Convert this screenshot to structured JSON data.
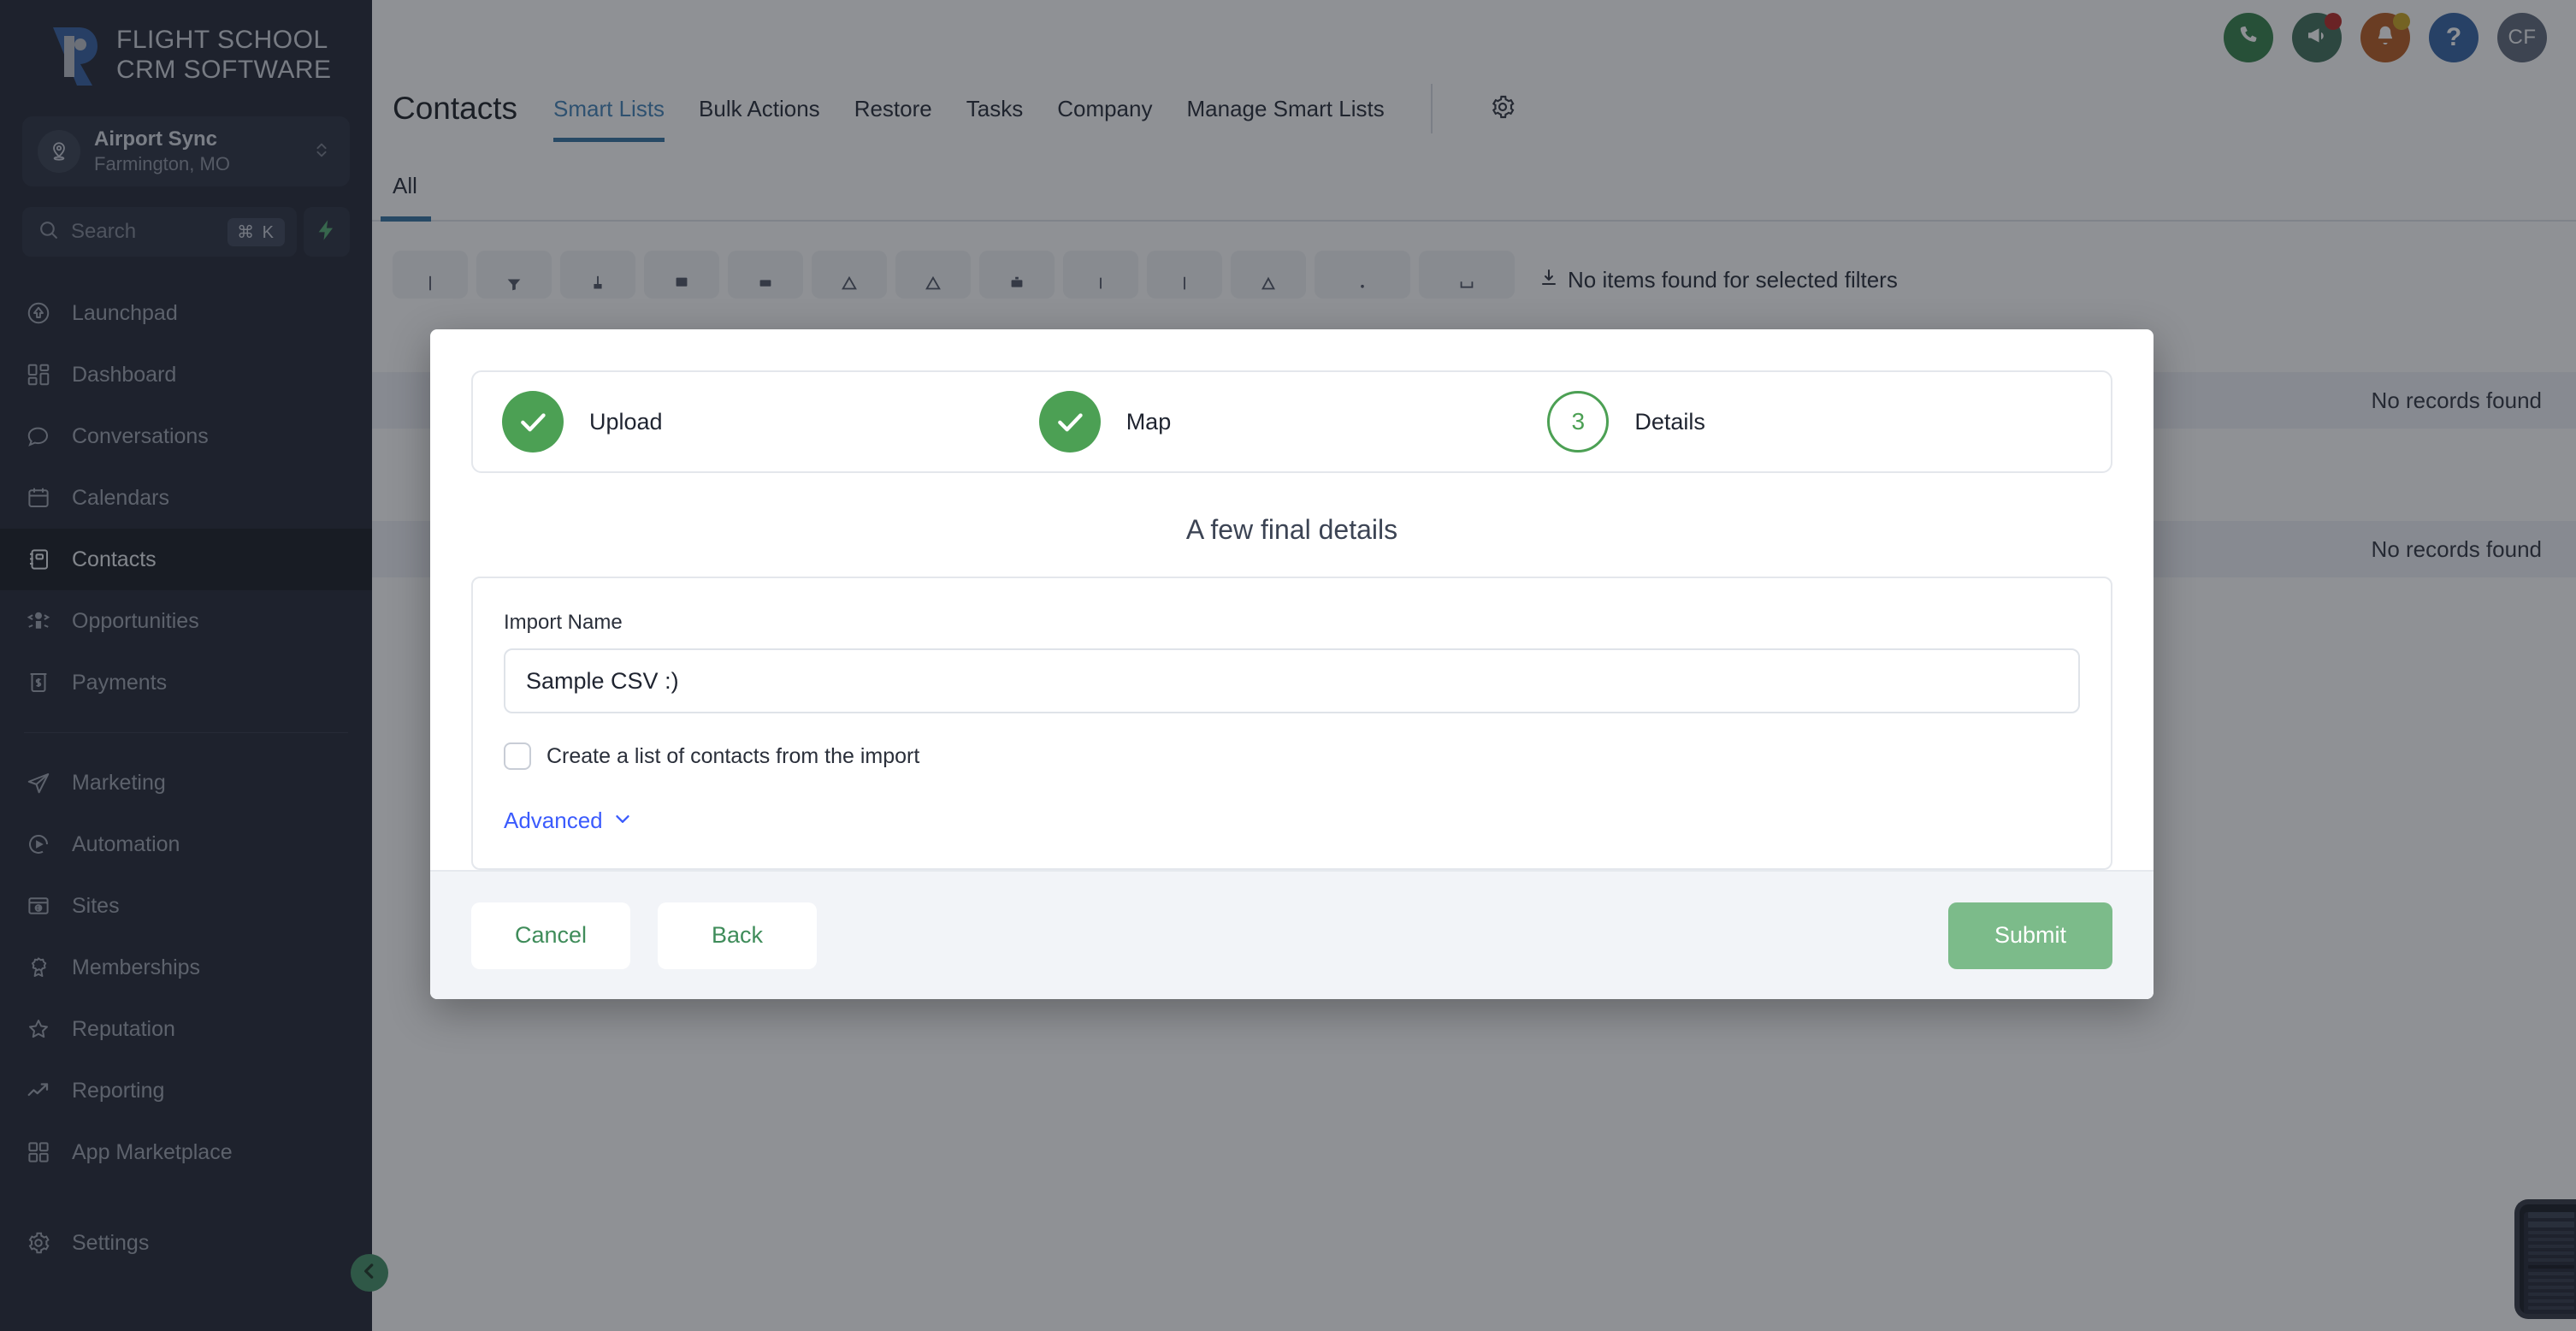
{
  "brand": {
    "line1": "FLIGHT SCHOOL",
    "line2": "CRM SOFTWARE",
    "logo_icon": "flight-school-r-logo"
  },
  "org": {
    "name": "Airport Sync",
    "location": "Farmington, MO",
    "avatar_icon": "location-pin-icon",
    "chevron_icon": "chevron-up-down-icon"
  },
  "search": {
    "placeholder": "Search",
    "shortcut": "⌘ K",
    "search_icon": "search-icon",
    "bolt_icon": "lightning-bolt-icon",
    "bolt_color": "#4ea86f"
  },
  "sidebar": {
    "items": [
      {
        "label": "Launchpad",
        "icon": "rocket-launchpad-icon",
        "active": false
      },
      {
        "label": "Dashboard",
        "icon": "dashboard-grid-icon",
        "active": false
      },
      {
        "label": "Conversations",
        "icon": "chat-bubble-icon",
        "active": false
      },
      {
        "label": "Calendars",
        "icon": "calendar-icon",
        "active": false
      },
      {
        "label": "Contacts",
        "icon": "contacts-book-icon",
        "active": true
      },
      {
        "label": "Opportunities",
        "icon": "opportunities-icon",
        "active": false
      },
      {
        "label": "Payments",
        "icon": "payments-dollar-icon",
        "active": false
      }
    ],
    "items2": [
      {
        "label": "Marketing",
        "icon": "paper-plane-icon",
        "active": false
      },
      {
        "label": "Automation",
        "icon": "automation-play-icon",
        "active": false
      },
      {
        "label": "Sites",
        "icon": "sites-window-icon",
        "active": false
      },
      {
        "label": "Memberships",
        "icon": "ribbon-badge-icon",
        "active": false
      },
      {
        "label": "Reputation",
        "icon": "star-icon",
        "active": false
      },
      {
        "label": "Reporting",
        "icon": "trend-up-icon",
        "active": false
      },
      {
        "label": "App Marketplace",
        "icon": "app-grid-icon",
        "active": false
      }
    ],
    "settings": {
      "label": "Settings",
      "icon": "gear-icon"
    },
    "collapse_icon": "chevron-left-icon",
    "collapse_color": "#3f8c63"
  },
  "topbar": {
    "actions": [
      {
        "icon": "phone-icon",
        "color": "#2f7d45",
        "badge": null
      },
      {
        "icon": "megaphone-icon",
        "color": "#3b6b55",
        "badge": "#b5231f"
      },
      {
        "icon": "bell-icon",
        "color": "#b5571b",
        "badge": "#c9a21b"
      },
      {
        "icon": "question-icon",
        "color": "#2f5ea0",
        "badge": null
      }
    ],
    "avatar": {
      "initials": "CF",
      "color": "#5a6576"
    }
  },
  "page": {
    "title": "Contacts",
    "tabs": [
      {
        "label": "Smart Lists",
        "active": true
      },
      {
        "label": "Bulk Actions",
        "active": false
      },
      {
        "label": "Restore",
        "active": false
      },
      {
        "label": "Tasks",
        "active": false
      },
      {
        "label": "Company",
        "active": false
      },
      {
        "label": "Manage Smart Lists",
        "active": false
      }
    ],
    "settings_icon": "gear-icon",
    "subtab": "All",
    "empty_filters_text": "No items found for selected filters",
    "no_records_text": "No records found"
  },
  "modal": {
    "steps": [
      {
        "label": "Upload",
        "state": "done",
        "marker": "✓"
      },
      {
        "label": "Map",
        "state": "done",
        "marker": "✓"
      },
      {
        "label": "Details",
        "state": "current",
        "marker": "3"
      }
    ],
    "heading": "A few final details",
    "import_name_label": "Import Name",
    "import_name_value": "Sample CSV :)",
    "import_name_placeholder": "Import Name",
    "checkbox_label": "Create a list of contacts from the import",
    "checkbox_checked": false,
    "advanced_label": "Advanced",
    "advanced_icon": "chevron-down-icon",
    "buttons": {
      "cancel": "Cancel",
      "back": "Back",
      "submit": "Submit"
    },
    "accent_green": "#4CA054",
    "submit_green": "#7cbb8a",
    "link_blue": "#3b5bfd"
  }
}
